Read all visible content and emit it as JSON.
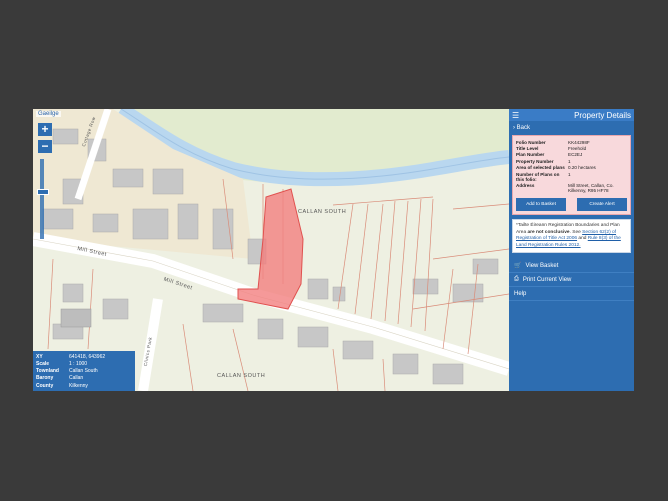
{
  "map": {
    "language_toggle": "Gaeilge",
    "zoom_in": "+",
    "zoom_out": "−",
    "labels": {
      "callan_south_top": "CALLAN SOUTH",
      "mill_street_1": "Mill Street",
      "mill_street_2": "Mill Street",
      "callan_south_bottom": "CALLAN SOUTH",
      "cottage_row": "Cottage Row",
      "clinic_park": "Clinics Park"
    }
  },
  "info": {
    "rows": [
      {
        "k": "XY",
        "v": "641418, 643962"
      },
      {
        "k": "Scale",
        "v": "1 : 1000"
      },
      {
        "k": "Townland",
        "v": "Callan South"
      },
      {
        "k": "Barony",
        "v": "Callan"
      },
      {
        "k": "County",
        "v": "Kilkenny"
      }
    ]
  },
  "panel": {
    "title": "Property Details",
    "back": "Back",
    "props": [
      {
        "k": "Folio Number",
        "v": "KK44298F"
      },
      {
        "k": "Title Level",
        "v": "Freehold"
      },
      {
        "k": "Plan Number",
        "v": "EC2EJ"
      },
      {
        "k": "Property Number",
        "v": "1"
      },
      {
        "k": "Area of selected plans",
        "v": "0.20 hectares"
      },
      {
        "k": "Number of Plans on this folio:",
        "v": "1"
      },
      {
        "k": "Address",
        "v": "Mill Street, Callan, Co. Kilkenny, R95 HF78"
      }
    ],
    "add_to_basket": "Add to Basket",
    "create_alert": "Create Alert",
    "notice": {
      "p1": "*Tailte Éireann Registration Boundaries and Plan Area ",
      "p2": "are not conclusive",
      "p3": ". See ",
      "link1": "Section 62(2) of Registration of Title Act 2006",
      "p4": " and ",
      "link2": "Rule 8(3) of the Land Registration Rules 2012."
    },
    "view_basket": "View Basket",
    "print_current_view": "Print Current View",
    "help": "Help"
  },
  "colors": {
    "accent": "#2d6db1",
    "river": "#b9d7ef",
    "parcel": "#f2807f"
  }
}
